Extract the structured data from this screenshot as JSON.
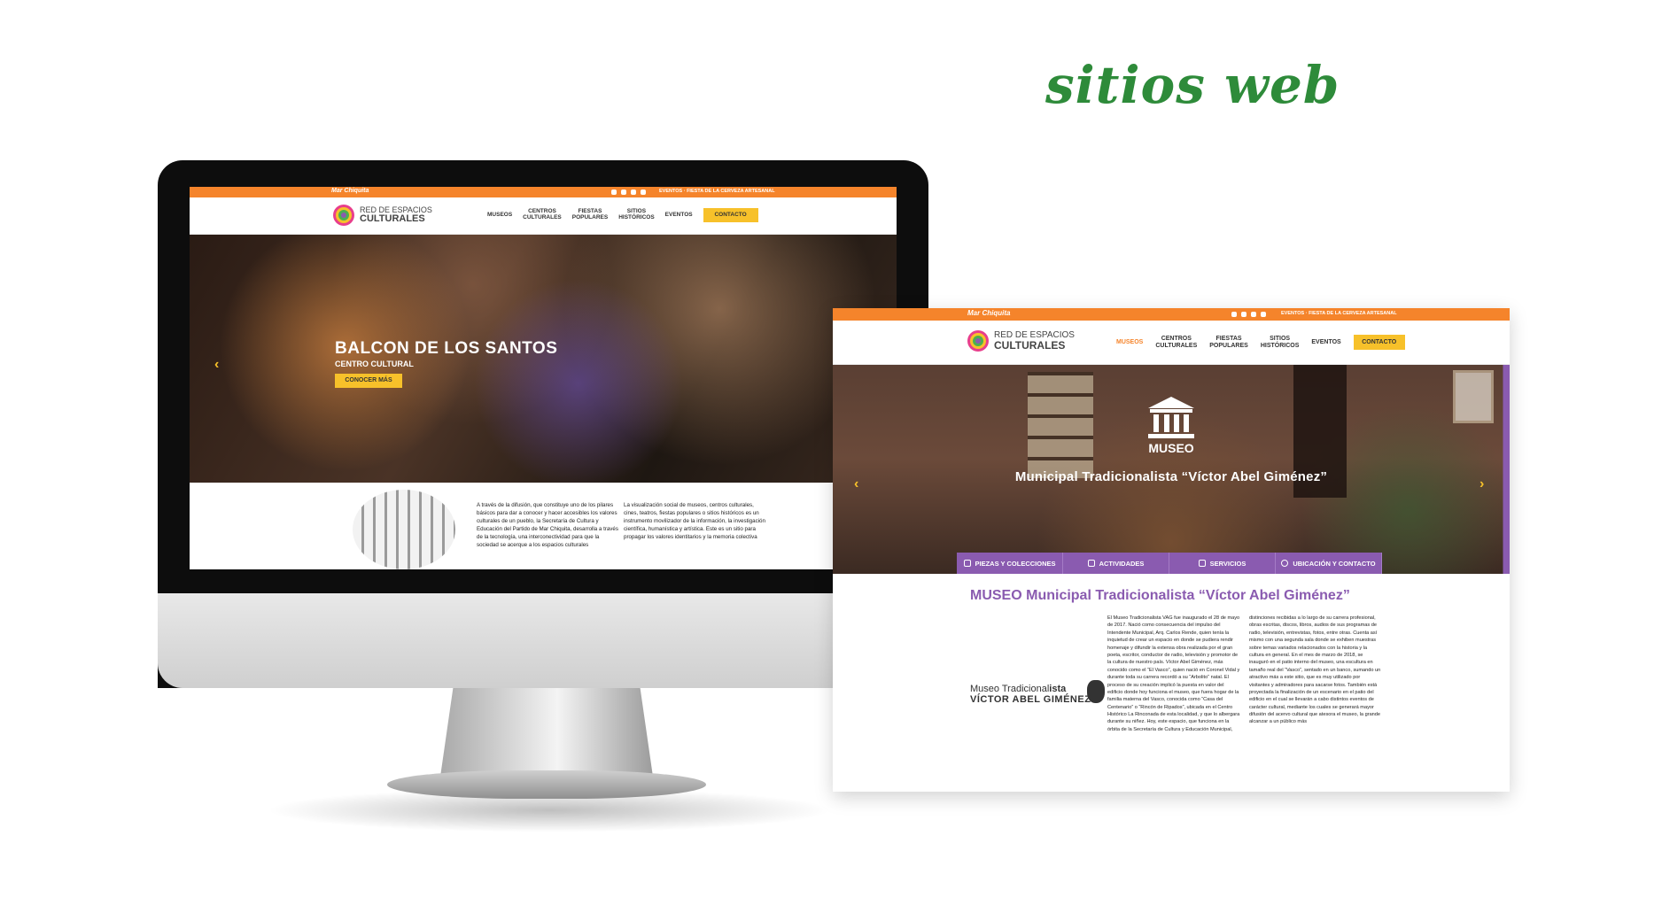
{
  "headline": "sitios web",
  "site": {
    "brand_small": "Mar Chiquita",
    "topbar_events": "EVENTOS · FIESTA DE LA CERVEZA ARTESANAL",
    "logo_line1": "RED DE ESPACIOS",
    "logo_line2": "CULTURALES",
    "nav": [
      {
        "label1": "MUSEOS",
        "label2": ""
      },
      {
        "label1": "CENTROS",
        "label2": "CULTURALES"
      },
      {
        "label1": "FIESTAS",
        "label2": "POPULARES"
      },
      {
        "label1": "SITIOS",
        "label2": "HISTÓRICOS"
      },
      {
        "label1": "EVENTOS",
        "label2": ""
      }
    ],
    "contact_label": "CONTACTO"
  },
  "home": {
    "hero_title": "BALCON DE LOS SANTOS",
    "hero_subtitle": "CENTRO CULTURAL",
    "hero_button": "CONOCER MÁS",
    "arrow_left": "‹",
    "col1": "A través de la difusión, que constituye uno de los pilares básicos para dar a conocer y hacer accesibles los valores culturales de un pueblo, la Secretaría de Cultura y Educación del Partido de Mar Chiquita, desarrolla a través de la tecnología, una interconectividad para que la sociedad se acerque a los espacios culturales",
    "col2": "La visualización social de museos, centros culturales, cines, teatros, fiestas populares o sitios históricos es un instrumento movilizador de la información, la investigación científica, humanística y artística. Este es un sitio para propagar los valores identitarios y la memoria colectiva"
  },
  "museum": {
    "hero_label": "MUSEO",
    "hero_name": "Municipal Tradicionalista “Víctor Abel Giménez”",
    "arrow_left": "‹",
    "arrow_right": "›",
    "tabs": [
      "PIEZAS Y COLECCIONES",
      "ACTIVIDADES",
      "SERVICIOS",
      "UBICACIÓN Y CONTACTO"
    ],
    "title": "MUSEO Municipal Tradicionalista “Víctor Abel Giménez”",
    "logo_line1_a": "Museo Tradicional",
    "logo_line1_b": "ista",
    "logo_line2": "VÍCTOR ABEL GIMÉNEZ",
    "col1": "El Museo Tradicionalista VAG fue inaugurado el 28 de mayo de 2017. Nació como consecuencia del impulso del Intendente Municipal, Arq. Carlos Rende, quien tenía la inquietud de crear un espacio en donde se pudiera rendir homenaje y difundir la extensa obra realizada por el gran poeta, escritor, conductor de radio, televisión y promotor de la cultura de nuestro país. Víctor Abel Giménez, más conocido como el “El Vasco”, quien nació en Coronel Vidal y durante toda su carrera recordó a su “Arbolito” natal. El proceso de su creación implicó la puesta en valor del edificio donde hoy funciona el museo, que fuera hogar de la familia materna del Vasco, conocida como “Casa del Centenario” o “Rincón de Ripados”, ubicada en el Centro Histórico La Rinconada de esta localidad, y que lo albergara durante su niñez. Hoy, este espacio, que funciona en la órbita de la Secretaría de Cultura y Educación Municipal,",
    "col2": "distinciones recibidas a lo largo de su carrera profesional, obras escritas, discos, libros, audios de sus programas de radio, televisión, entrevistas, fotos, entre otras. Cuenta así mismo con una segunda sala donde se exhiben muestras sobre temas variados relacionados con la historia y la cultura en general. En el mes de marzo de 2018, se inauguró en el patio interno del museo, una escultura en tamaño real del “Vasco”, sentado en un banco, sumando un atractivo más a este sitio, que es muy utilizado por visitantes y admiradores para sacarse fotos. También está proyectada la finalización de un escenario en el patio del edificio en el cual se llevarán a cabo distintos eventos de carácter cultural, mediante los cuales se generará mayor difusión del acervo cultural que atesora el museo, la grande alcanzar a un público más"
  },
  "colors": {
    "orange": "#f5842b",
    "yellow": "#f7c12a",
    "purple": "#8a5bb0",
    "green": "#2e8b3a"
  }
}
